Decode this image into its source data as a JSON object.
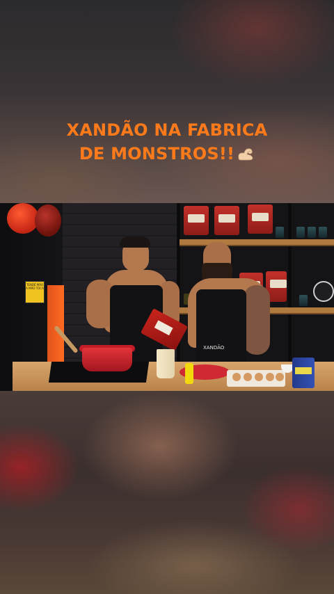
{
  "headline": {
    "line1": "XANDÃO NA FABRICA",
    "line2": "DE MONSTROS!!",
    "emoji": "flexed-biceps-icon",
    "color": "#ff7a1a"
  },
  "video": {
    "sign_text": "TENDÊ MÃO A MÃO TOCA",
    "apron_text": "XANDÃO"
  }
}
